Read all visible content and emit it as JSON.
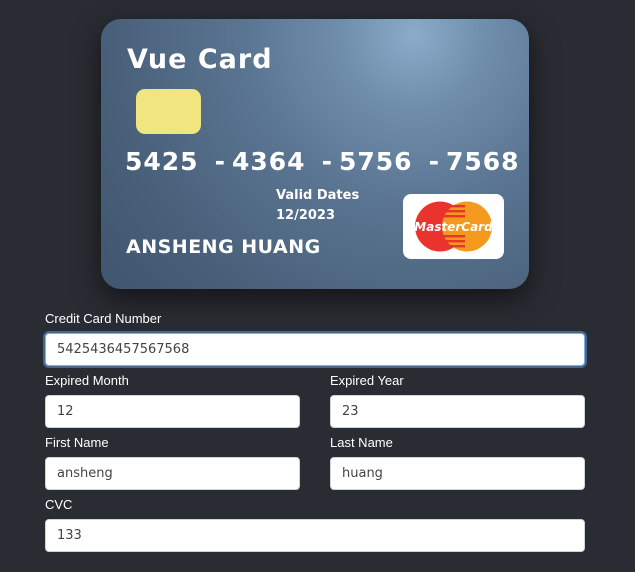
{
  "card": {
    "title": "Vue Card",
    "number_groups": [
      "5425",
      "4364",
      "5756",
      "7568"
    ],
    "valid_label": "Valid Dates",
    "valid_value": "12/2023",
    "holder": "ANSHENG HUANG",
    "brand": "MasterCard"
  },
  "form": {
    "card_number_label": "Credit Card Number",
    "card_number_value": "5425436457567568",
    "expired_month_label": "Expired Month",
    "expired_month_value": "12",
    "expired_year_label": "Expired Year",
    "expired_year_value": "23",
    "first_name_label": "First Name",
    "first_name_value": "ansheng",
    "last_name_label": "Last Name",
    "last_name_value": "huang",
    "cvc_label": "CVC",
    "cvc_value": "133"
  },
  "colors": {
    "background": "#2a2c33",
    "chip": "#f0e57e",
    "mc_red": "#e9332c",
    "mc_orange": "#f39a1e",
    "focus_ring": "#7fb0e6"
  }
}
